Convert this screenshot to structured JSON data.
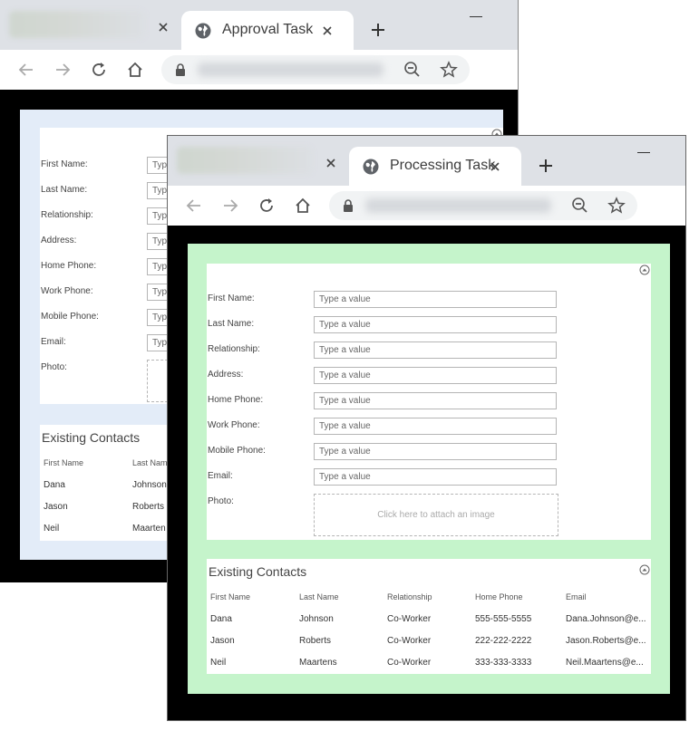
{
  "back_window": {
    "tab_title": "Approval Task",
    "form": {
      "fields": [
        {
          "label": "First Name:",
          "placeholder": "Typ"
        },
        {
          "label": "Last Name:",
          "placeholder": "Typ"
        },
        {
          "label": "Relationship:",
          "placeholder": "Typ"
        },
        {
          "label": "Address:",
          "placeholder": "Typ"
        },
        {
          "label": "Home Phone:",
          "placeholder": "Typ"
        },
        {
          "label": "Work Phone:",
          "placeholder": "Typ"
        },
        {
          "label": "Mobile Phone:",
          "placeholder": "Typ"
        },
        {
          "label": "Email:",
          "placeholder": "Typ"
        }
      ],
      "photo_label": "Photo:"
    },
    "contacts": {
      "title": "Existing Contacts",
      "columns": [
        "First Name",
        "Last Nam"
      ],
      "rows": [
        [
          "Dana",
          "Johnson"
        ],
        [
          "Jason",
          "Roberts"
        ],
        [
          "Neil",
          "Maarten"
        ]
      ]
    }
  },
  "front_window": {
    "tab_title": "Processing Task",
    "form": {
      "fields": [
        {
          "label": "First Name:",
          "placeholder": "Type a value"
        },
        {
          "label": "Last Name:",
          "placeholder": "Type a value"
        },
        {
          "label": "Relationship:",
          "placeholder": "Type a value"
        },
        {
          "label": "Address:",
          "placeholder": "Type a value"
        },
        {
          "label": "Home Phone:",
          "placeholder": "Type a value"
        },
        {
          "label": "Work Phone:",
          "placeholder": "Type a value"
        },
        {
          "label": "Mobile Phone:",
          "placeholder": "Type a value"
        },
        {
          "label": "Email:",
          "placeholder": "Type a value"
        }
      ],
      "photo_label": "Photo:",
      "photo_hint": "Click here to attach an image"
    },
    "contacts": {
      "title": "Existing Contacts",
      "columns": [
        "First Name",
        "Last Name",
        "Relationship",
        "Home Phone",
        "Email"
      ],
      "rows": [
        [
          "Dana",
          "Johnson",
          "Co-Worker",
          "555-555-5555",
          "Dana.Johnson@e..."
        ],
        [
          "Jason",
          "Roberts",
          "Co-Worker",
          "222-222-2222",
          "Jason.Roberts@e..."
        ],
        [
          "Neil",
          "Maartens",
          "Co-Worker",
          "333-333-3333",
          "Neil.Maartens@e..."
        ]
      ]
    }
  },
  "colors": {
    "back_form_bg": "#e3ecf8",
    "front_form_bg": "#c5f4cb",
    "tabstrip": "#dee1e6",
    "omnibox": "#f1f3f4"
  },
  "icons": [
    "globe-icon",
    "close-icon",
    "plus-icon",
    "back-arrow-icon",
    "forward-arrow-icon",
    "reload-icon",
    "home-icon",
    "lock-icon",
    "zoom-out-icon",
    "star-icon",
    "collapse-up-icon"
  ]
}
